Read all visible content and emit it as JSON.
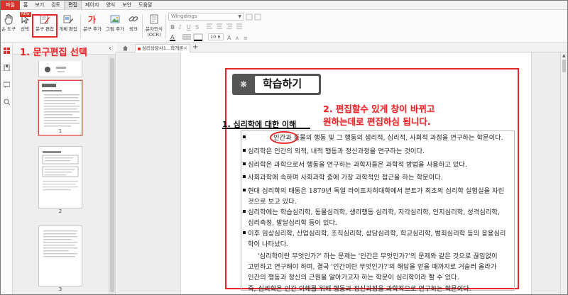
{
  "menu": {
    "items": [
      {
        "label": "파일",
        "kind": "file"
      },
      {
        "label": "홈",
        "kind": "normal"
      },
      {
        "label": "보기",
        "kind": "normal"
      },
      {
        "label": "검토",
        "kind": "normal"
      },
      {
        "label": "편집",
        "kind": "active"
      },
      {
        "label": "페이지",
        "kind": "normal"
      },
      {
        "label": "양식",
        "kind": "normal"
      },
      {
        "label": "보안",
        "kind": "normal"
      },
      {
        "label": "도움말",
        "kind": "normal"
      }
    ]
  },
  "ribbon": {
    "new_badge": "NEW",
    "tools": [
      {
        "label": "손 도구",
        "icon": "hand-icon"
      },
      {
        "label": "선택",
        "icon": "cursor-icon"
      },
      {
        "label": "문구 편집",
        "icon": "edit-text-icon"
      },
      {
        "label": "개체 편집",
        "icon": "edit-object-icon"
      },
      {
        "label": "문구 추가",
        "icon": "add-text-icon"
      },
      {
        "label": "그림 추가",
        "icon": "add-image-icon"
      },
      {
        "label": "링크",
        "icon": "link-icon"
      },
      {
        "label": "문자인식\n(OCR)",
        "icon": "ocr-icon"
      }
    ],
    "font_name": "Wingdings",
    "font_size": "10.6"
  },
  "thumbnails": {
    "page_numbers": [
      "1",
      "2",
      "3"
    ]
  },
  "tab": {
    "title": "심리상담사1...학개론"
  },
  "document": {
    "title": "학습하기",
    "section": "1. 심리학에 대한 이해",
    "lines": [
      "인간과 동물의 행동 및 그 행동의 생리적, 심리적, 사회적 과정을 연구하는 학문이다.",
      "심리학은 인간의 외적, 내적 행동과 정신과정을 연구하는 것이다.",
      "심리학은 과학으로서 행동을 연구하는 과학자들은 과학적 방법을 사용하고 있다.",
      "사회과학에 속하며 사회과학 중에 가장 과학적인 접근을 하는 학문이다.",
      "현대 심리학의 태동은 1879년 독일 라이프치히대학에서 분트가 최초의 심리학 실험실을 차린",
      "것으로 보고 있다.",
      "심리학에는 학습심리학, 동물심리학, 생리행동 심리학, 지각심리학, 인지심리학, 성격심리학,",
      "심리측정, 발달심리학 등이 있다.",
      "이후 임상심리학, 산업심리학, 조직심리학, 상담심리학, 학교심리학, 범죄심리학 등의 응용심리",
      "학이 나타났다.",
      "'심리학이란 무엇인가?' 하는 문제는 '인간은 무엇인가?'의 문제와 같은 것으로 끊임없이",
      "고민하고 연구해야 하며, 결국 '인간이란 무엇인가?'의 해답을 얻을 때까지로 거슬러 올라가",
      "인간의 행동과 정신의 근원을 알아가고자 하는 학문이 심리학이라 할 수 있다.",
      "즉, 심리학은 인간 이해를 위해 행동과 정신과정을 과학적으로 연구하는 학문이다."
    ]
  },
  "annotations": {
    "step1": "1. 문구편집 선택",
    "step2_line1": "2. 편집할수 있게 창이 바뀌고",
    "step2_line2": "원하는데로 편집하심 됩니다."
  },
  "colors": {
    "accent_red": "#e5262a",
    "file_menu_red": "#d9342b"
  }
}
